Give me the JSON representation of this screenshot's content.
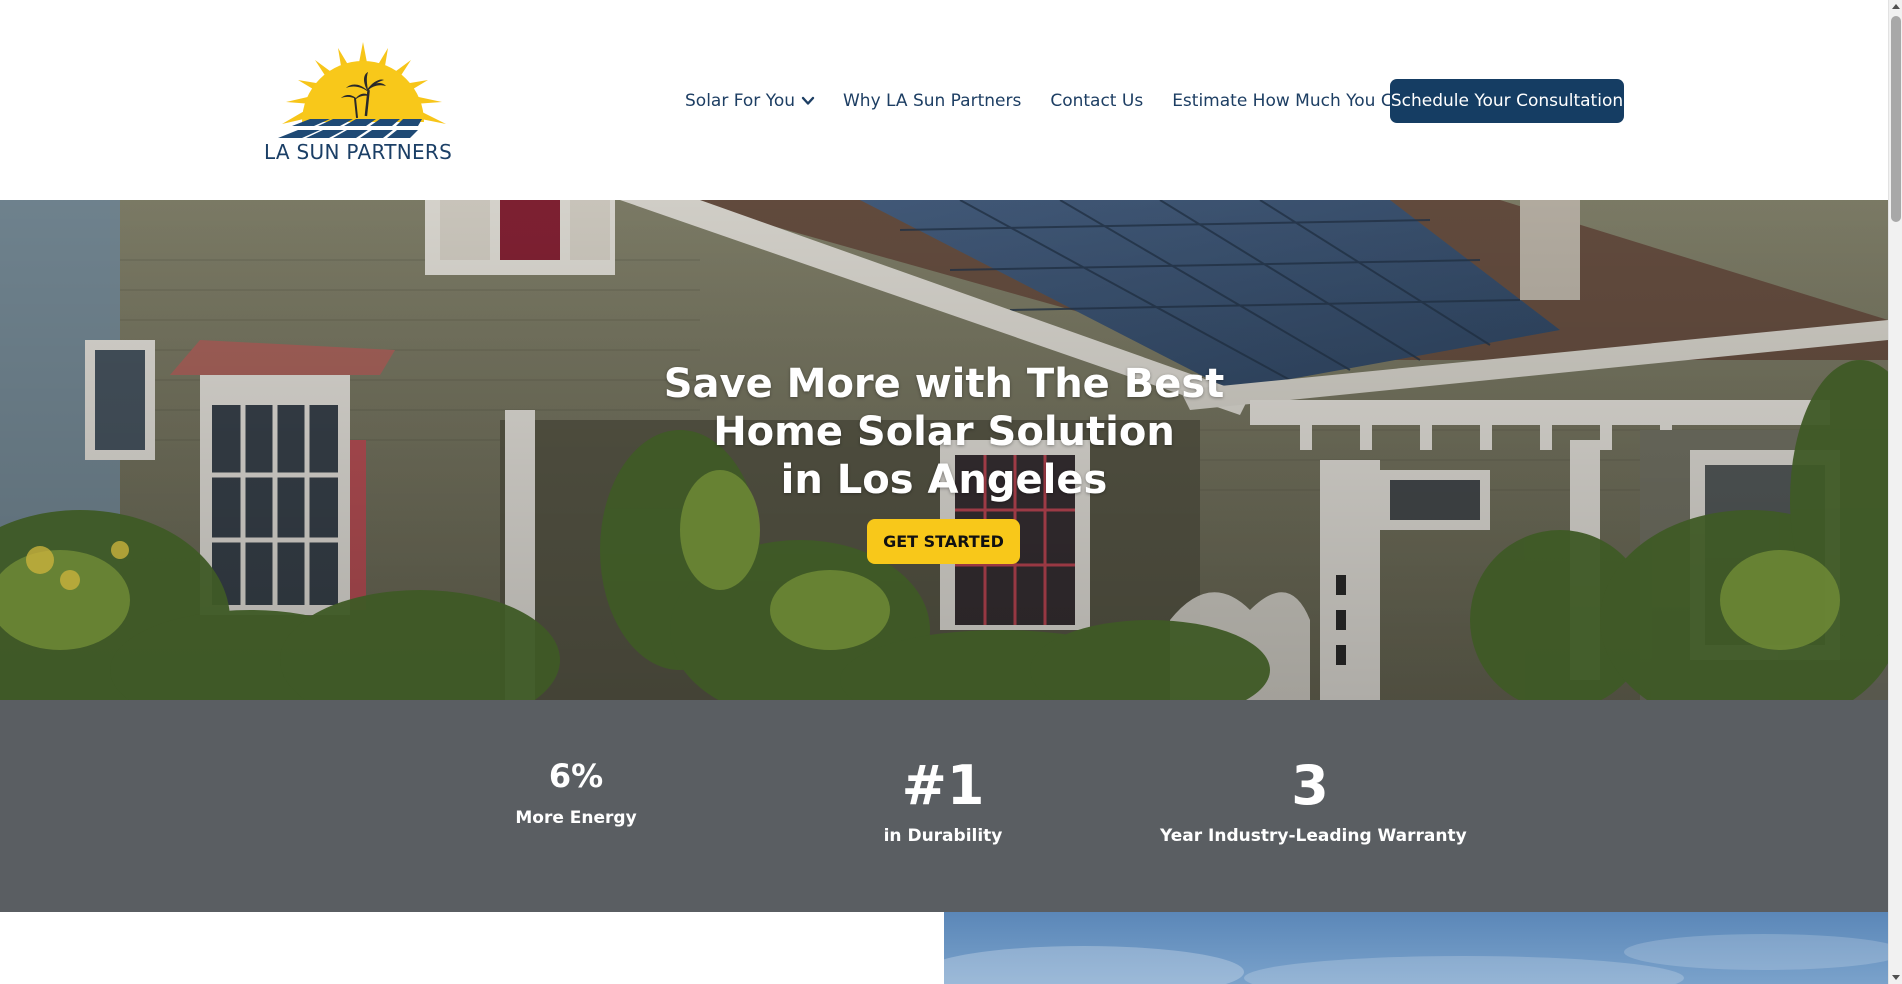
{
  "brand": {
    "name": "LA SUN PARTNERS",
    "colors": {
      "primary": "#153d63",
      "accent": "#f8c81a",
      "stats_background": "#5a5e62"
    }
  },
  "nav": {
    "items": [
      {
        "label": "Solar For You",
        "icon": "chevron-down-icon"
      },
      {
        "label": "Why LA Sun Partners"
      },
      {
        "label": "Contact Us"
      },
      {
        "label": "Estimate How Much You Can Save"
      }
    ],
    "cta_label": "Schedule Your Consultation"
  },
  "hero": {
    "title_lines": [
      "Save More with The Best",
      "Home Solar Solution",
      "in Los Angeles"
    ],
    "button_label": "GET STARTED"
  },
  "stats": [
    {
      "value": "6%",
      "label": "More Energy"
    },
    {
      "value": "#1",
      "label": "in Durability"
    },
    {
      "value": "3",
      "label": "Year Industry-Leading Warranty"
    }
  ]
}
